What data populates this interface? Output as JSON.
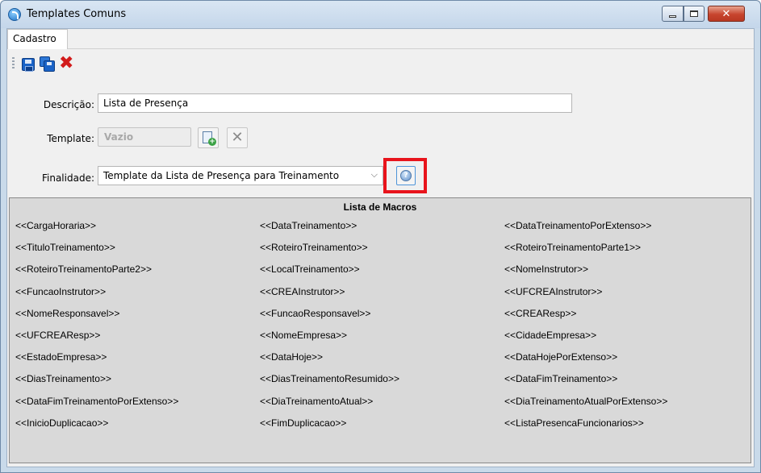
{
  "window": {
    "title": "Templates Comuns"
  },
  "tabs": [
    {
      "label": "Cadastro"
    }
  ],
  "toolbar": {
    "save_icon": "save-icon",
    "save_all_icon": "save-all-icon",
    "delete_icon": "delete-icon"
  },
  "form": {
    "descricao_label": "Descrição:",
    "descricao_value": "Lista de Presença",
    "template_label": "Template:",
    "template_value": "Vazio",
    "finalidade_label": "Finalidade:",
    "finalidade_value": "Template da Lista de Presença para Treinamento"
  },
  "macros": {
    "title": "Lista de Macros",
    "items": [
      "<<CargaHoraria>>",
      "<<DataTreinamento>>",
      "<<DataTreinamentoPorExtenso>>",
      "<<TituloTreinamento>>",
      "<<RoteiroTreinamento>>",
      "<<RoteiroTreinamentoParte1>>",
      "<<RoteiroTreinamentoParte2>>",
      "<<LocalTreinamento>>",
      "<<NomeInstrutor>>",
      "<<FuncaoInstrutor>>",
      "<<CREAInstrutor>>",
      "<<UFCREAInstrutor>>",
      "<<NomeResponsavel>>",
      "<<FuncaoResponsavel>>",
      "<<CREAResp>>",
      "<<UFCREAResp>>",
      "<<NomeEmpresa>>",
      "<<CidadeEmpresa>>",
      "<<EstadoEmpresa>>",
      "<<DataHoje>>",
      "<<DataHojePorExtenso>>",
      "<<DiasTreinamento>>",
      "<<DiasTreinamentoResumido>>",
      "<<DataFimTreinamento>>",
      "<<DataFimTreinamentoPorExtenso>>",
      "<<DiaTreinamentoAtual>>",
      "<<DiaTreinamentoAtualPorExtenso>>",
      "<<InicioDuplicacao>>",
      "<<FimDuplicacao>>",
      "<<ListaPresencaFuncionarios>>"
    ]
  },
  "colors": {
    "highlight": "#e8141c",
    "close_button": "#c7452e",
    "accent": "#1a63c7"
  }
}
